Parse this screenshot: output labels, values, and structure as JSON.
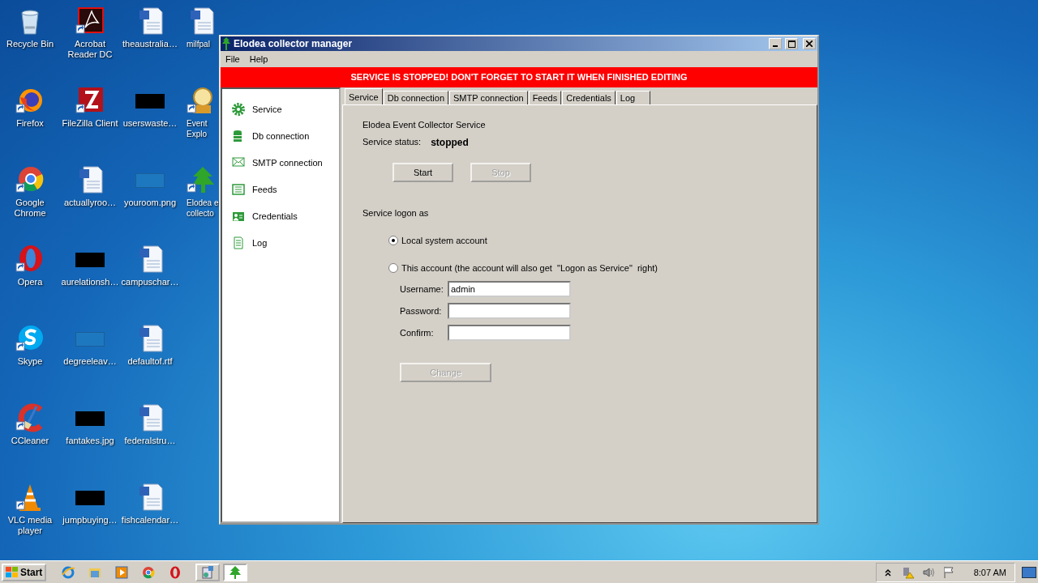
{
  "desktop": {
    "columns": [
      [
        {
          "label": "Recycle Bin",
          "kind": "recycle",
          "shortcut": false
        },
        {
          "label": "Firefox",
          "kind": "firefox",
          "shortcut": true
        },
        {
          "label": "Google Chrome",
          "kind": "chrome",
          "shortcut": true
        },
        {
          "label": "Opera",
          "kind": "opera",
          "shortcut": true
        },
        {
          "label": "Skype",
          "kind": "skype",
          "shortcut": true
        },
        {
          "label": "CCleaner",
          "kind": "ccleaner",
          "shortcut": true
        },
        {
          "label": "VLC media player",
          "kind": "vlc",
          "shortcut": true
        }
      ],
      [
        {
          "label": "Acrobat Reader DC",
          "kind": "acrobat",
          "shortcut": true
        },
        {
          "label": "FileZilla Client",
          "kind": "filezilla",
          "shortcut": true
        },
        {
          "label": "actuallyroo…",
          "kind": "word",
          "shortcut": false
        },
        {
          "label": "aurelationsh…",
          "kind": "black",
          "shortcut": false
        },
        {
          "label": "degreeleav…",
          "kind": "blank",
          "shortcut": false
        },
        {
          "label": "fantakes.jpg",
          "kind": "black",
          "shortcut": false
        },
        {
          "label": "jumpbuying…",
          "kind": "black",
          "shortcut": false
        }
      ],
      [
        {
          "label": "theaustralia…",
          "kind": "word",
          "shortcut": false
        },
        {
          "label": "userswaste…",
          "kind": "black",
          "shortcut": false
        },
        {
          "label": "youroom.png",
          "kind": "blank",
          "shortcut": false
        },
        {
          "label": "campuschar…",
          "kind": "word",
          "shortcut": false
        },
        {
          "label": "defaultof.rtf",
          "kind": "word",
          "shortcut": false
        },
        {
          "label": "federalstru…",
          "kind": "word",
          "shortcut": false
        },
        {
          "label": "fishcalendar…",
          "kind": "word",
          "shortcut": false
        }
      ],
      [
        {
          "label": "milfpal",
          "kind": "word",
          "shortcut": false
        },
        {
          "label": "Event\nExplo",
          "kind": "event",
          "shortcut": true
        },
        {
          "label": "Elodea e\ncollecto",
          "kind": "elodea",
          "shortcut": true
        }
      ]
    ]
  },
  "window": {
    "title": "Elodea collector manager",
    "menu": [
      "File",
      "Help"
    ],
    "banner": "SERVICE IS STOPPED! DON'T FORGET TO START IT WHEN FINISHED EDITING",
    "sidebar": [
      {
        "label": "Service",
        "kind": "gear"
      },
      {
        "label": "Db connection",
        "kind": "database"
      },
      {
        "label": "SMTP connection",
        "kind": "envelope"
      },
      {
        "label": "Feeds",
        "kind": "list"
      },
      {
        "label": "Credentials",
        "kind": "idcard"
      },
      {
        "label": "Log",
        "kind": "page"
      }
    ],
    "tabs": [
      {
        "label": "Service",
        "selected": true
      },
      {
        "label": "Db connection",
        "selected": false
      },
      {
        "label": "SMTP connection",
        "selected": false
      },
      {
        "label": "Feeds",
        "selected": false
      },
      {
        "label": "Credentials",
        "selected": false
      },
      {
        "label": "Log",
        "selected": false
      }
    ],
    "panel": {
      "heading": "Elodea Event Collector Service",
      "status_label": "Service status:",
      "status": "stopped",
      "buttons": [
        {
          "label": "Start",
          "disabled": false
        },
        {
          "label": "Stop",
          "disabled": true
        }
      ],
      "logon_label": "Service logon as",
      "radios": [
        {
          "label": "Local system account",
          "selected": true
        },
        {
          "label": "This account (the account will also get  \"Logon as Service\"  right)",
          "selected": false
        }
      ],
      "fields": [
        {
          "label": "Username:",
          "value": "admin"
        },
        {
          "label": "Password:"
        },
        {
          "label": "Confirm:"
        }
      ],
      "change_button": {
        "label": "Change",
        "disabled": true
      }
    }
  },
  "taskbar": {
    "start": "Start",
    "quick_launch": [
      {
        "kind": "ie"
      },
      {
        "kind": "folder"
      },
      {
        "kind": "media"
      },
      {
        "kind": "chrome"
      },
      {
        "kind": "opera"
      }
    ],
    "tasks": [
      {
        "kind": "installer",
        "selected": false
      },
      {
        "kind": "elodea",
        "selected": true
      }
    ],
    "tray": [
      {
        "kind": "chevron"
      },
      {
        "kind": "network"
      },
      {
        "kind": "speaker"
      },
      {
        "kind": "flag"
      }
    ],
    "clock": "8:07 AM"
  }
}
